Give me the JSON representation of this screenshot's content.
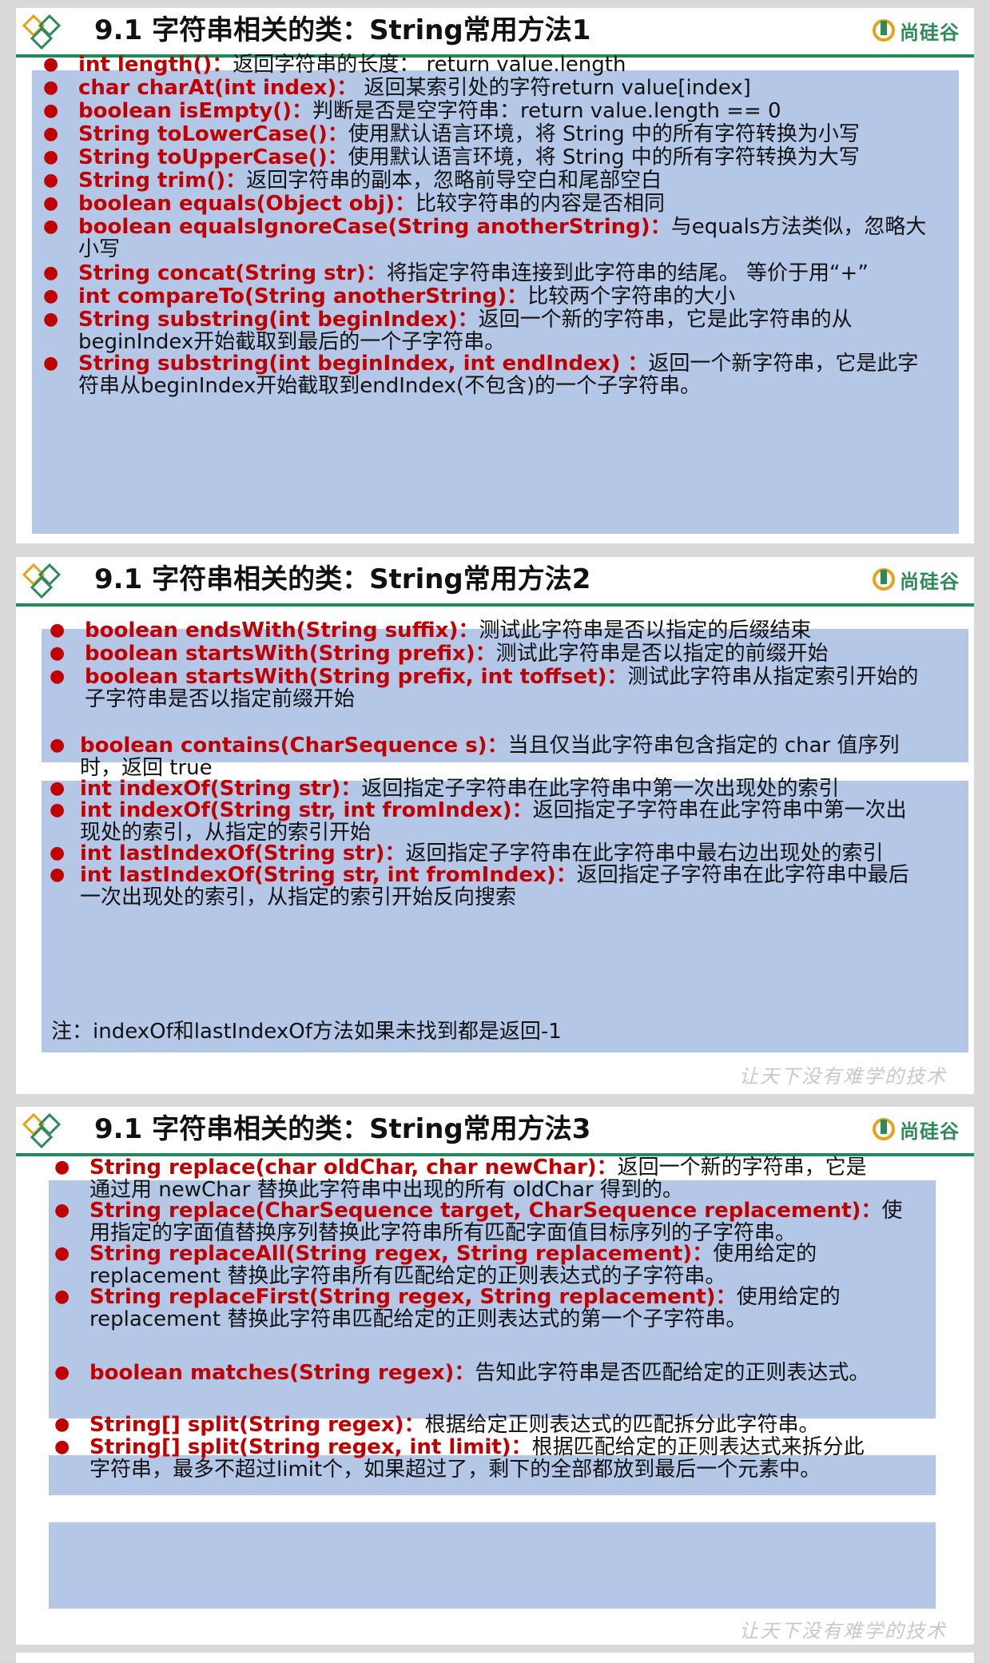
{
  "brand": {
    "name": "尚硅谷"
  },
  "slides": [
    {
      "title": "9.1 字符串相关的类：String常用方法1",
      "items": [
        {
          "sig": "int length()：",
          "desc": "返回字符串的长度： return value.length",
          "cont": ""
        },
        {
          "sig": "char charAt(int index)：",
          "desc": " 返回某索引处的字符return value[index]",
          "cont": ""
        },
        {
          "sig": "boolean isEmpty()：",
          "desc": "判断是否是空字符串：return value.length == 0",
          "cont": ""
        },
        {
          "sig": "String toLowerCase()：",
          "desc": "使用默认语言环境，将 String 中的所有字符转换为小写",
          "cont": ""
        },
        {
          "sig": "String toUpperCase()：",
          "desc": "使用默认语言环境，将 String 中的所有字符转换为大写",
          "cont": ""
        },
        {
          "sig": "String trim()：",
          "desc": "返回字符串的副本，忽略前导空白和尾部空白",
          "cont": ""
        },
        {
          "sig": "boolean equals(Object obj)：",
          "desc": "比较字符串的内容是否相同",
          "cont": ""
        },
        {
          "sig": "boolean equalsIgnoreCase(String anotherString)：",
          "desc": "与equals方法类似，忽略大",
          "cont": "小写"
        },
        {
          "sig": "String concat(String str)：",
          "desc": "将指定字符串连接到此字符串的结尾。 等价于用“+”",
          "cont": ""
        },
        {
          "sig": "int compareTo(String anotherString)：",
          "desc": "比较两个字符串的大小",
          "cont": ""
        },
        {
          "sig": "String substring(int beginIndex)：",
          "desc": "返回一个新的字符串，它是此字符串的从",
          "cont": "beginIndex开始截取到最后的一个子字符串。"
        },
        {
          "sig": "String substring(int beginIndex, int endIndex) ：",
          "desc": "返回一个新字符串，它是此字",
          "cont": "符串从beginIndex开始截取到endIndex(不包含)的一个子字符串。"
        }
      ]
    },
    {
      "title": "9.1 字符串相关的类：String常用方法2",
      "box1": [
        {
          "sig": "boolean endsWith(String suffix)：",
          "desc": "测试此字符串是否以指定的后缀结束",
          "cont": ""
        },
        {
          "sig": "boolean startsWith(String prefix)：",
          "desc": "测试此字符串是否以指定的前缀开始",
          "cont": ""
        },
        {
          "sig": "boolean startsWith(String prefix, int toffset)：",
          "desc": "测试此字符串从指定索引开始的",
          "cont": "子字符串是否以指定前缀开始"
        }
      ],
      "box2": [
        {
          "sig": "boolean contains(CharSequence s)：",
          "desc": "当且仅当此字符串包含指定的 char 值序列",
          "cont": "时，返回 true"
        },
        {
          "sig": "int indexOf(String str)：",
          "desc": "返回指定子字符串在此字符串中第一次出现处的索引",
          "cont": ""
        },
        {
          "sig": "int indexOf(String str, int fromIndex)：",
          "desc": "返回指定子字符串在此字符串中第一次出",
          "cont": "现处的索引，从指定的索引开始"
        },
        {
          "sig": "int lastIndexOf(String str)：",
          "desc": "返回指定子字符串在此字符串中最右边出现处的索引",
          "cont": ""
        },
        {
          "sig": "int lastIndexOf(String str, int fromIndex)：",
          "desc": "返回指定子字符串在此字符串中最后",
          "cont": "一次出现处的索引，从指定的索引开始反向搜索"
        }
      ],
      "note": "注：indexOf和lastIndexOf方法如果未找到都是返回-1",
      "watermark": "让天下没有难学的技术"
    },
    {
      "title": "9.1 字符串相关的类：String常用方法3",
      "box1": [
        {
          "sig": "String replace(char oldChar, char newChar)：",
          "desc": "返回一个新的字符串，它是",
          "cont": "通过用 newChar 替换此字符串中出现的所有 oldChar 得到的。"
        },
        {
          "sig": "String replace(CharSequence target, CharSequence replacement)：",
          "desc": "使",
          "cont": "用指定的字面值替换序列替换此字符串所有匹配字面值目标序列的子字符串。"
        },
        {
          "sig": "String replaceAll(String regex, String replacement)：",
          "desc": "使用给定的",
          "cont": "replacement 替换此字符串所有匹配给定的正则表达式的子字符串。"
        },
        {
          "sig": "String replaceFirst(String regex, String replacement)：",
          "desc": "使用给定的",
          "cont": "replacement 替换此字符串匹配给定的正则表达式的第一个子字符串。"
        }
      ],
      "box2": [
        {
          "sig": "boolean matches(String regex)：",
          "desc": "告知此字符串是否匹配给定的正则表达式。",
          "cont": ""
        }
      ],
      "box3": [
        {
          "sig": "String[] split(String regex)：",
          "desc": "根据给定正则表达式的匹配拆分此字符串。",
          "cont": ""
        },
        {
          "sig": "String[] split(String regex, int limit)：",
          "desc": "根据匹配给定的正则表达式来拆分此",
          "cont": "字符串，最多不超过limit个，如果超过了，剩下的全部都放到最后一个元素中。"
        }
      ],
      "watermark": "让天下没有难学的技术"
    }
  ]
}
